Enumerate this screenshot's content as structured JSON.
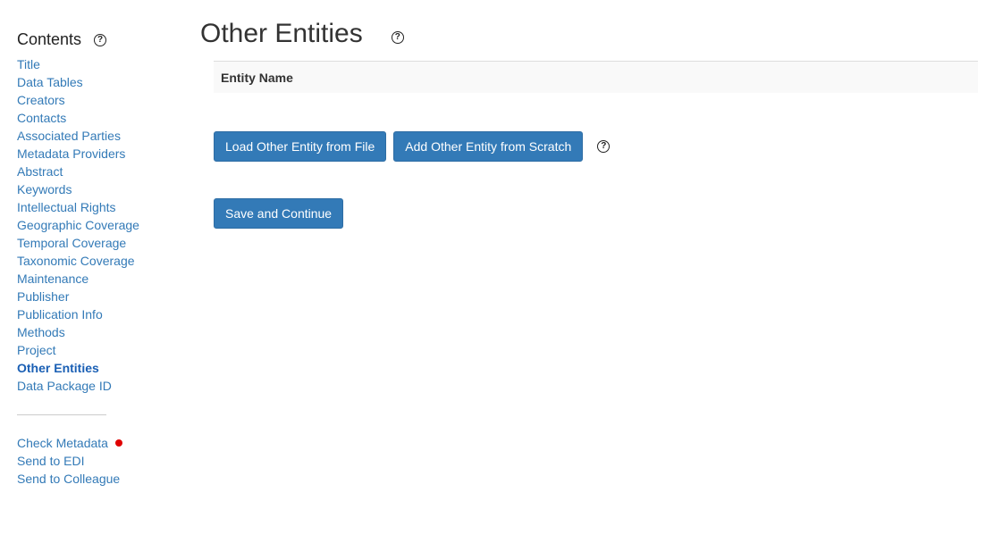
{
  "sidebar": {
    "heading": "Contents",
    "help_icon": "question-circle-icon",
    "items": [
      {
        "label": "Title"
      },
      {
        "label": "Data Tables"
      },
      {
        "label": "Creators"
      },
      {
        "label": "Contacts"
      },
      {
        "label": "Associated Parties"
      },
      {
        "label": "Metadata Providers"
      },
      {
        "label": "Abstract"
      },
      {
        "label": "Keywords"
      },
      {
        "label": "Intellectual Rights"
      },
      {
        "label": "Geographic Coverage"
      },
      {
        "label": "Temporal Coverage"
      },
      {
        "label": "Taxonomic Coverage"
      },
      {
        "label": "Maintenance"
      },
      {
        "label": "Publisher"
      },
      {
        "label": "Publication Info"
      },
      {
        "label": "Methods"
      },
      {
        "label": "Project"
      },
      {
        "label": "Other Entities",
        "active": true
      },
      {
        "label": "Data Package ID"
      }
    ],
    "actions": [
      {
        "label": "Check Metadata",
        "status": "red-dot"
      },
      {
        "label": "Send to EDI"
      },
      {
        "label": "Send to Colleague"
      }
    ]
  },
  "main": {
    "title": "Other Entities",
    "table": {
      "columns": [
        "Entity Name"
      ]
    },
    "buttons": {
      "load": "Load Other Entity from File",
      "add": "Add Other Entity from Scratch",
      "save": "Save and Continue"
    }
  },
  "help_glyph": "?",
  "colors": {
    "link": "#337ab7",
    "active_link": "#1a5fb4",
    "button": "#337ab7",
    "status_dot": "#e00000"
  }
}
